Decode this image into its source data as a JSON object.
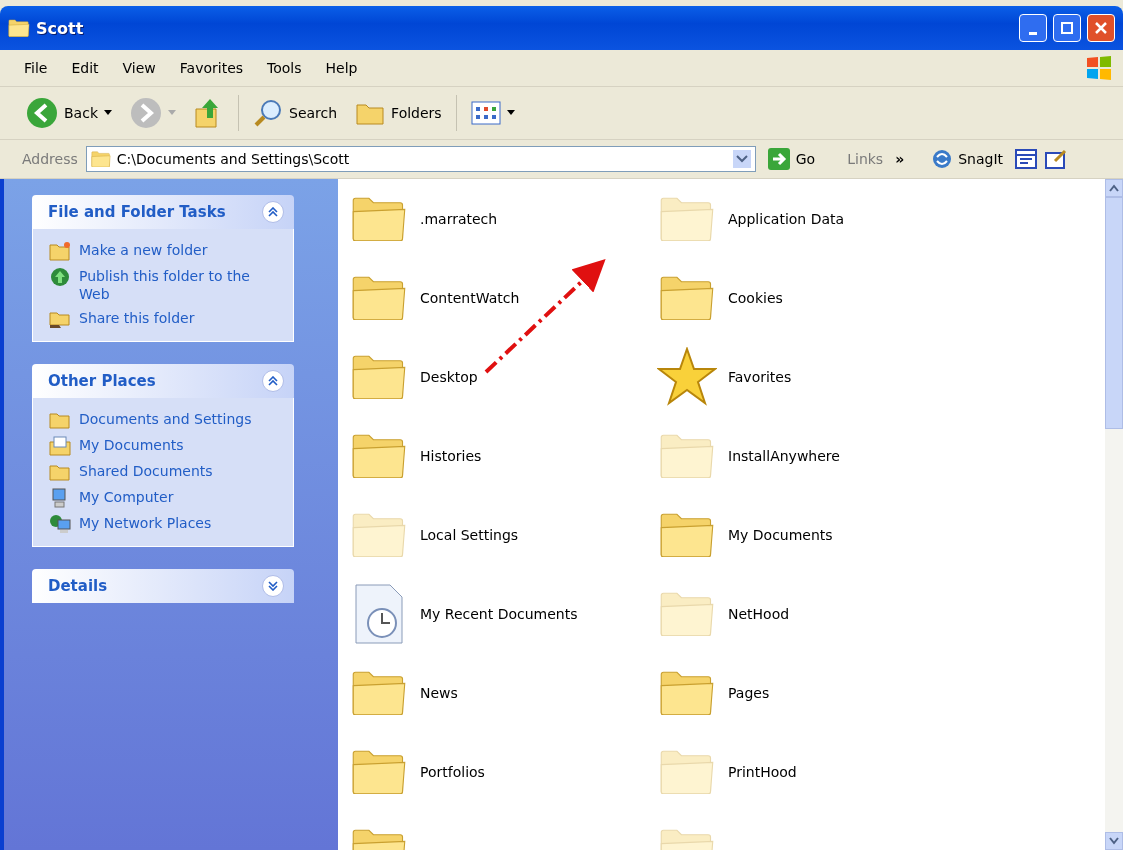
{
  "window": {
    "title": "Scott"
  },
  "menu": [
    "File",
    "Edit",
    "View",
    "Favorites",
    "Tools",
    "Help"
  ],
  "toolbar": {
    "back": "Back",
    "search": "Search",
    "folders": "Folders"
  },
  "address": {
    "label": "Address",
    "value": "C:\\Documents and Settings\\Scott",
    "go": "Go",
    "links": "Links",
    "chevron": "»",
    "snagit": "SnagIt"
  },
  "panels": [
    {
      "title": "File and Folder Tasks",
      "expanded": true,
      "items": [
        {
          "label": "Make a new folder",
          "kind": "newfolder"
        },
        {
          "label": "Publish this folder to the Web",
          "kind": "globe"
        },
        {
          "label": "Share this folder",
          "kind": "share"
        }
      ]
    },
    {
      "title": "Other Places",
      "expanded": true,
      "items": [
        {
          "label": "Documents and Settings",
          "kind": "folder"
        },
        {
          "label": "My Documents",
          "kind": "documents"
        },
        {
          "label": "Shared Documents",
          "kind": "folder"
        },
        {
          "label": "My Computer",
          "kind": "computer"
        },
        {
          "label": "My Network Places",
          "kind": "network"
        }
      ]
    },
    {
      "title": "Details",
      "expanded": false
    }
  ],
  "files": [
    {
      "name": ".marratech",
      "kind": "folder",
      "hidden": false
    },
    {
      "name": "Application Data",
      "kind": "folder",
      "hidden": true
    },
    {
      "name": "ContentWatch",
      "kind": "folder",
      "hidden": false
    },
    {
      "name": "Cookies",
      "kind": "folder",
      "hidden": false
    },
    {
      "name": "Desktop",
      "kind": "folder",
      "hidden": false
    },
    {
      "name": "Favorites",
      "kind": "favorites"
    },
    {
      "name": "Histories",
      "kind": "folder",
      "hidden": false
    },
    {
      "name": "InstallAnywhere",
      "kind": "folder",
      "hidden": true
    },
    {
      "name": "Local Settings",
      "kind": "folder",
      "hidden": true
    },
    {
      "name": "My Documents",
      "kind": "folder",
      "hidden": false
    },
    {
      "name": "My Recent Documents",
      "kind": "recent"
    },
    {
      "name": "NetHood",
      "kind": "folder",
      "hidden": true
    },
    {
      "name": "News",
      "kind": "folder",
      "hidden": false
    },
    {
      "name": "Pages",
      "kind": "folder",
      "hidden": false
    },
    {
      "name": "Portfolios",
      "kind": "folder",
      "hidden": false
    },
    {
      "name": "PrintHood",
      "kind": "folder",
      "hidden": true
    },
    {
      "kind": "folder",
      "hidden": false
    },
    {
      "kind": "folder",
      "hidden": true
    }
  ]
}
